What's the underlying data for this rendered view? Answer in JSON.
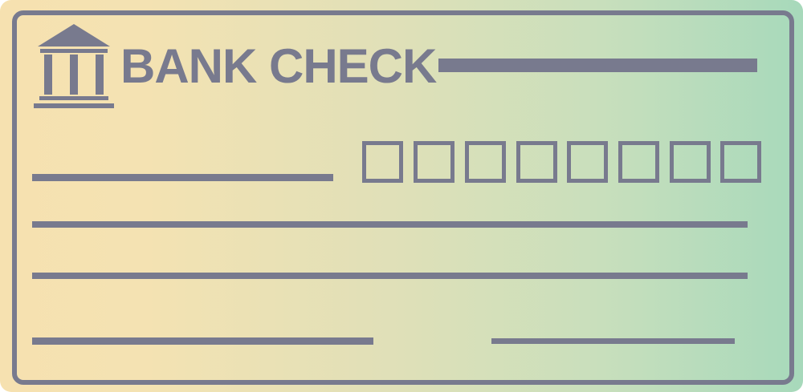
{
  "check": {
    "title": "BANK CHECK",
    "amount_box_count": 8
  },
  "icons": {
    "bank": "bank-building-icon"
  },
  "colors": {
    "ink": "#787a8e",
    "gradient_left": "#f6e1b0",
    "gradient_right": "#a7d9bb"
  }
}
